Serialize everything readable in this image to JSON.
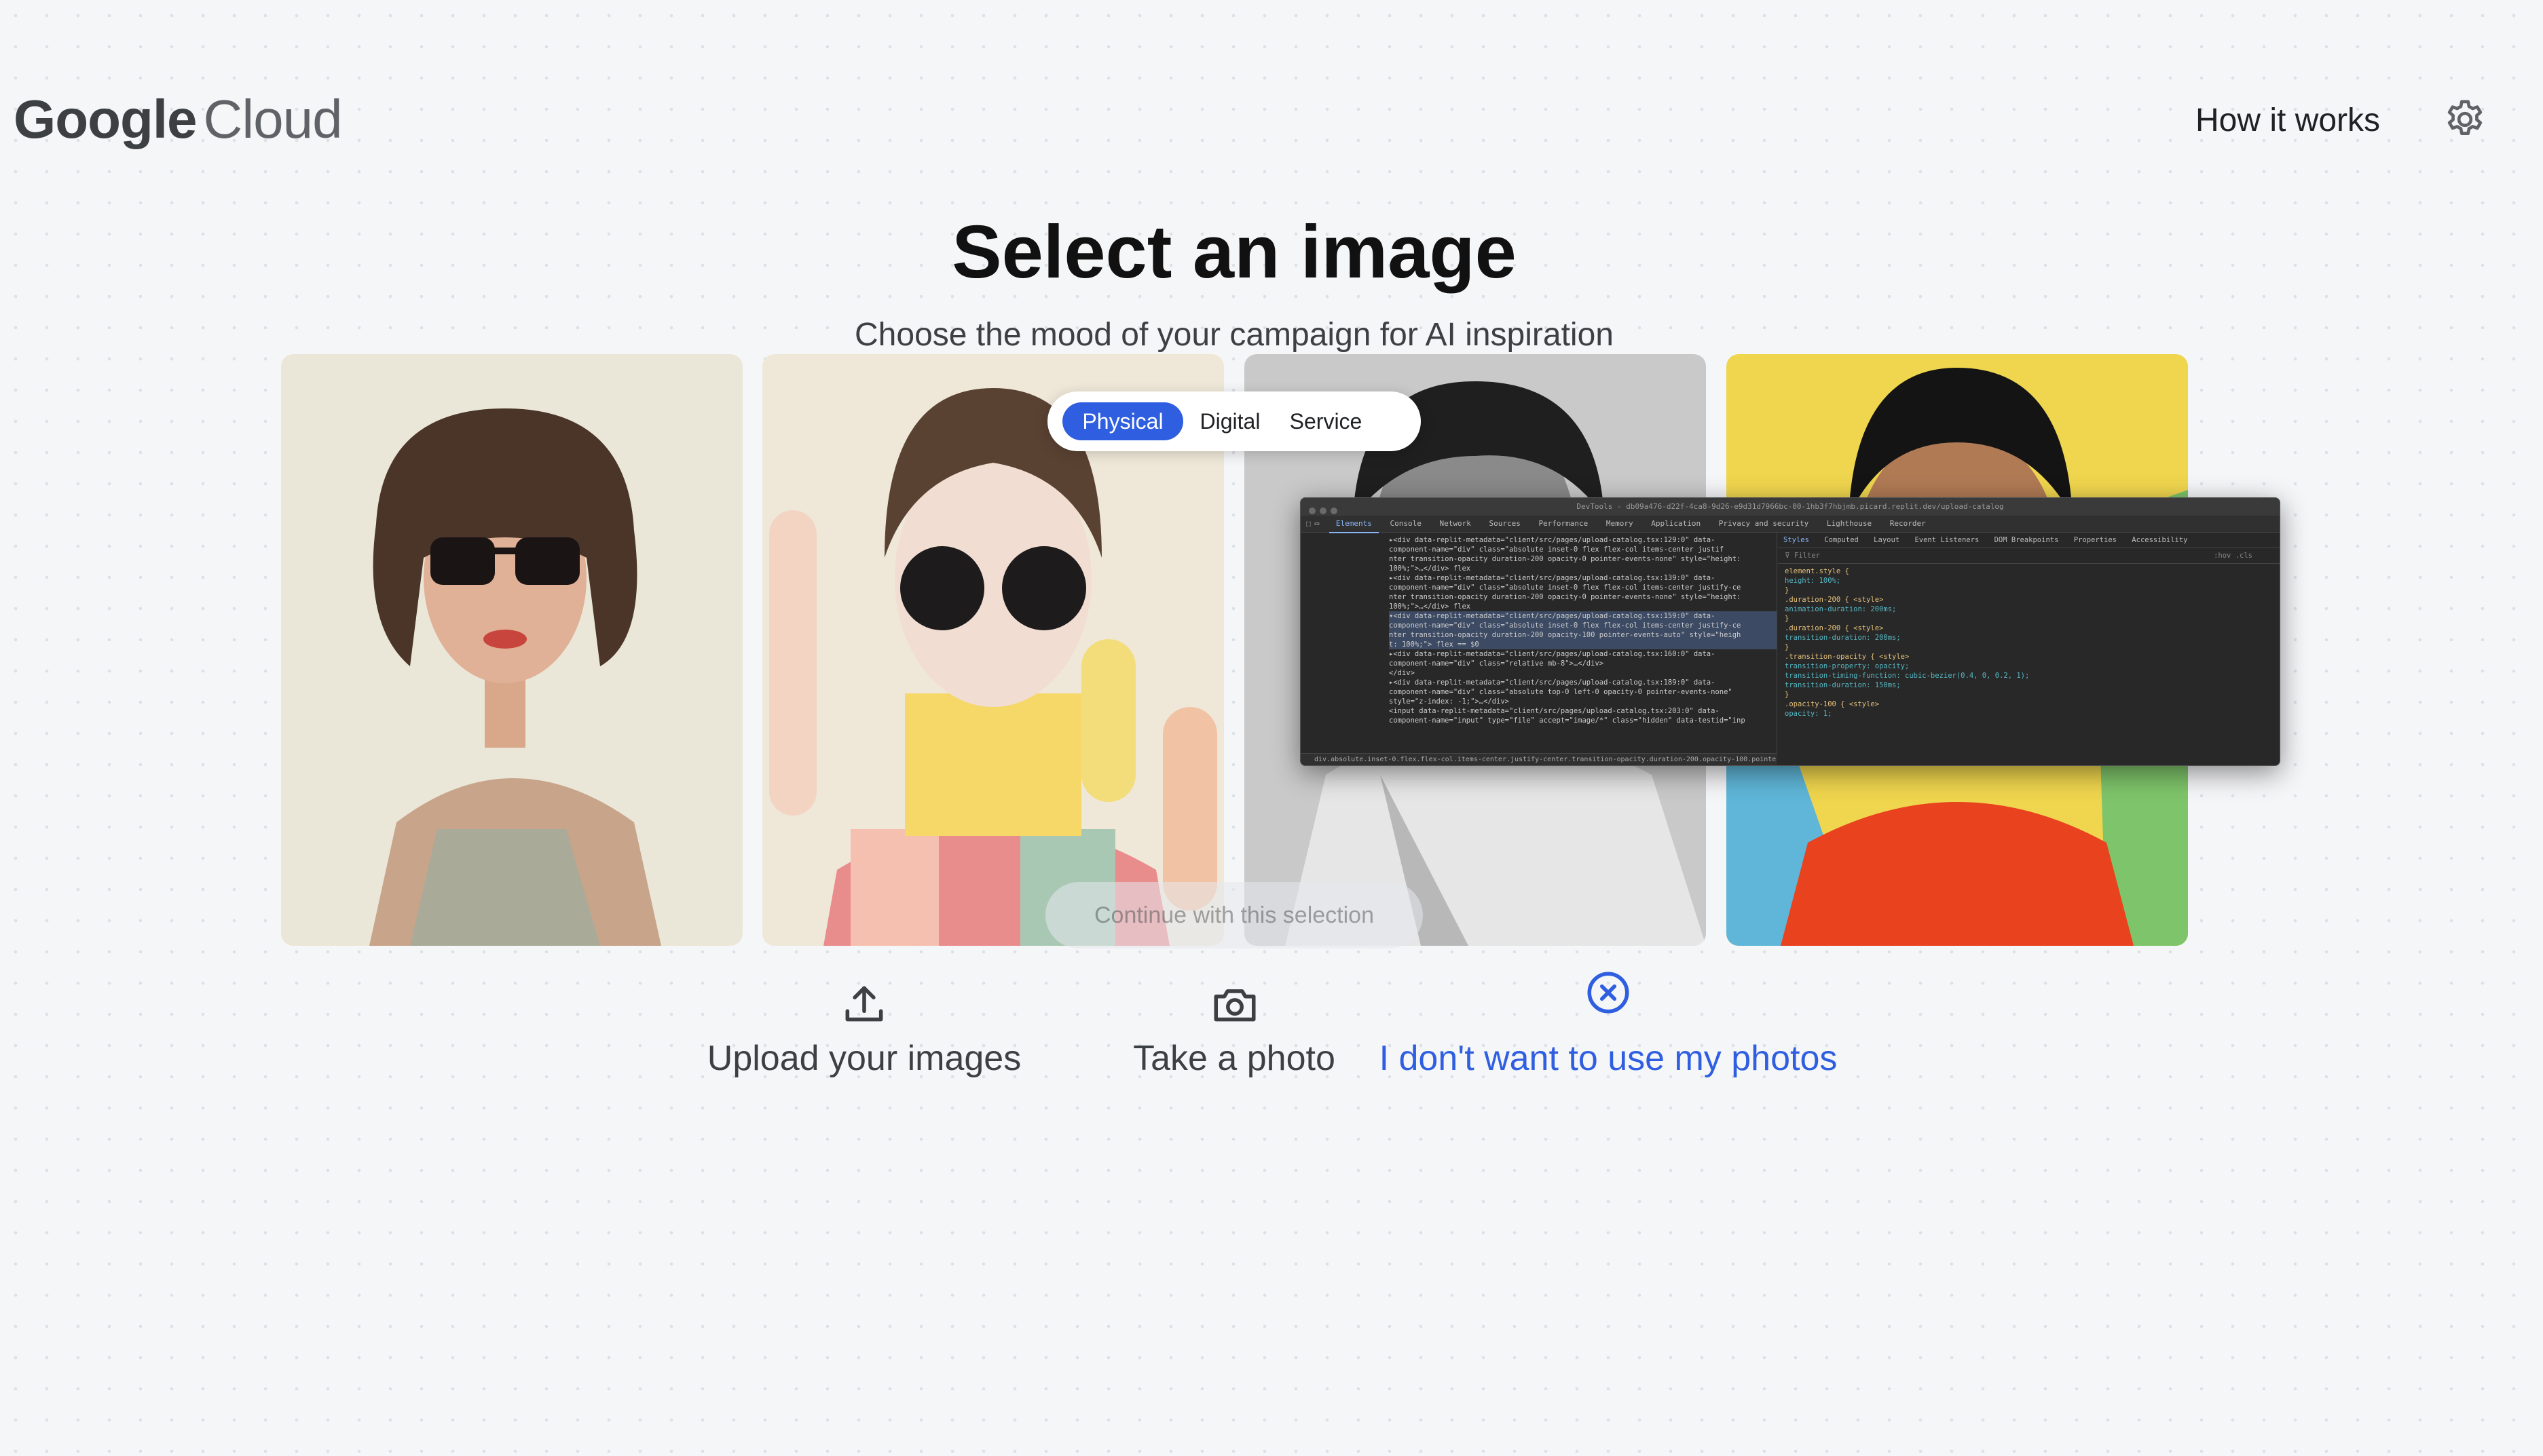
{
  "header": {
    "logo_google": "Google",
    "logo_cloud": "Cloud",
    "how_it_works": "How it works",
    "settings_icon": "gear-icon"
  },
  "main": {
    "title": "Select an image",
    "subtitle": "Choose the mood of your campaign for AI inspiration"
  },
  "category_toggle": {
    "options": [
      "Physical",
      "Digital",
      "Service"
    ],
    "selected": "Physical",
    "accent_color": "#2f5fe0"
  },
  "gallery": {
    "images": [
      {
        "alt": "Illustrated woman with bob haircut and dark sunglasses"
      },
      {
        "alt": "3D figure with round black sunglasses and colorful sweater"
      },
      {
        "alt": "Black and white portrait with white jacket"
      },
      {
        "alt": "Colorful portrait with red sunglasses and orange top"
      }
    ],
    "continue_label": "Continue with this selection"
  },
  "actions": {
    "upload_label": "Upload your images",
    "upload_icon": "upload-icon",
    "photo_label": "Take a photo",
    "photo_icon": "camera-icon",
    "decline_label": "I don't want to use my photos",
    "decline_icon": "close-circle-icon",
    "decline_color": "#2f5fe0"
  },
  "devtools": {
    "title": "DevTools - db09a476-d22f-4ca8-9d26-e9d31d7966bc-00-1hb3f7hbjmb.picard.replit.dev/upload-catalog",
    "tabs": [
      "Elements",
      "Console",
      "Network",
      "Sources",
      "Performance",
      "Memory",
      "Application",
      "Privacy and security",
      "Lighthouse",
      "Recorder"
    ],
    "active_tab": "Elements",
    "styles_tabs": [
      "Styles",
      "Computed",
      "Layout",
      "Event Listeners",
      "DOM Breakpoints",
      "Properties",
      "Accessibility"
    ],
    "active_styles_tab": "Styles",
    "filter_placeholder": "Filter",
    "filter_flags": ":hov .cls",
    "elements_lines": [
      "▸<div data-replit-metadata=\"client/src/pages/upload-catalog.tsx:129:0\" data-",
      "  component-name=\"div\" class=\"absolute inset-0 flex flex-col items-center justif",
      "  nter transition-opacity duration-200 opacity-0 pointer-events-none\" style=\"height:",
      "  100%;\">…</div> flex",
      "▸<div data-replit-metadata=\"client/src/pages/upload-catalog.tsx:139:0\" data-",
      "  component-name=\"div\" class=\"absolute inset-0 flex flex-col items-center justify-ce",
      "  nter transition-opacity duration-200 opacity-0 pointer-events-none\" style=\"height:",
      "  100%;\">…</div> flex",
      "▾<div data-replit-metadata=\"client/src/pages/upload-catalog.tsx:159:0\" data-",
      "  component-name=\"div\" class=\"absolute inset-0 flex flex-col items-center justify-ce",
      "  nter transition-opacity duration-200 opacity-100 pointer-events-auto\" style=\"heigh",
      "  t: 100%;\"> flex == $0",
      "   ▸<div data-replit-metadata=\"client/src/pages/upload-catalog.tsx:160:0\" data-",
      "    component-name=\"div\" class=\"relative mb-8\">…</div>",
      "  </div>",
      "▸<div data-replit-metadata=\"client/src/pages/upload-catalog.tsx:189:0\" data-",
      "  component-name=\"div\" class=\"absolute top-0 left-0 opacity-0 pointer-events-none\"",
      "  style=\"z-index: -1;\">…</div>",
      "  <input data-replit-metadata=\"client/src/pages/upload-catalog.tsx:203:0\" data-",
      "  component-name=\"input\" type=\"file\" accept=\"image/*\" class=\"hidden\" data-testid=\"inp"
    ],
    "highlight_lines": [
      8,
      9,
      10,
      11
    ],
    "style_rules": [
      "element.style {",
      "  height: 100%;",
      "}",
      ".duration-200 {                                               <style>",
      "  animation-duration: 200ms;",
      "}",
      ".duration-200 {                                               <style>",
      "  transition-duration: 200ms;",
      "}",
      ".transition-opacity {                                         <style>",
      "  transition-property: opacity;",
      "  transition-timing-function: cubic-bezier(0.4, 0, 0.2, 1);",
      "  transition-duration: 150ms;",
      "}",
      ".opacity-100 {                                                <style>",
      "  opacity: 1;"
    ],
    "breadcrumb": "div.absolute.inset-0.flex.flex-col.items-center.justify-center.transition-opacity.duration-200.opacity-100.pointer-even"
  }
}
